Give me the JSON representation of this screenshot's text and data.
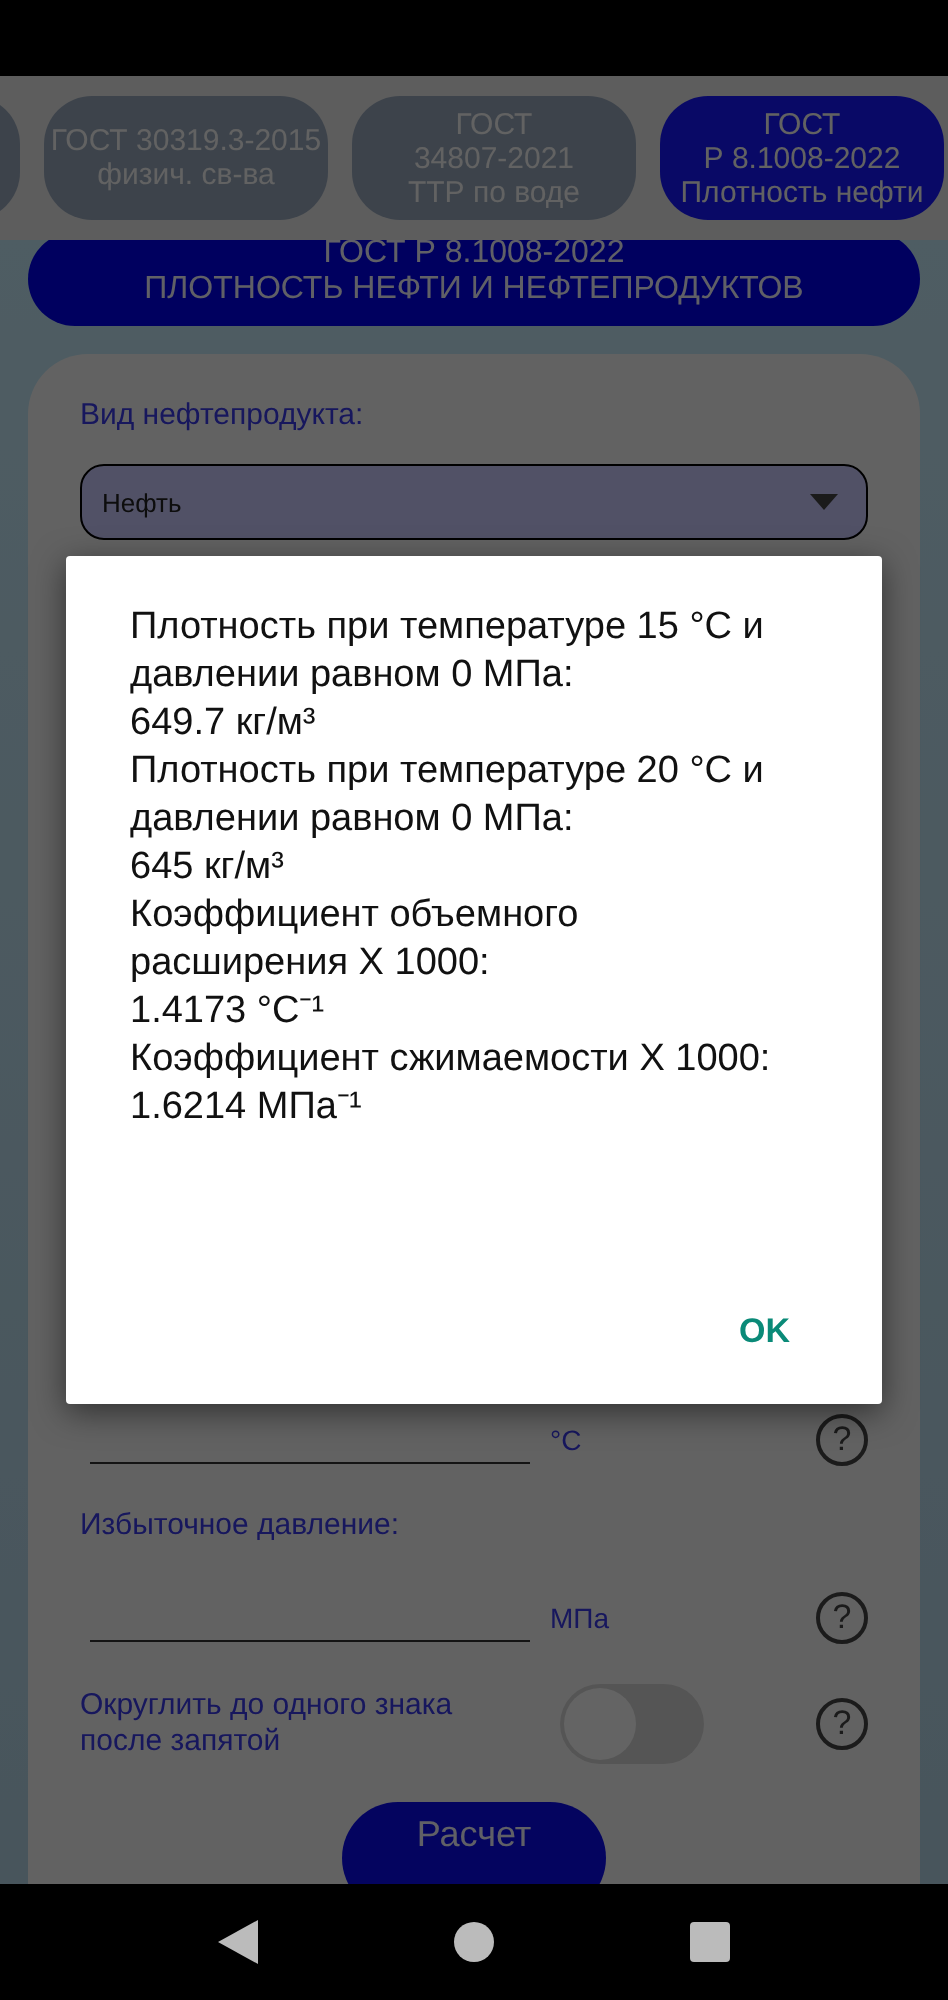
{
  "tabs": [
    {
      "label": "ГОСТ 30319.3-2015\nфизич. св-ва",
      "selected": false
    },
    {
      "label": "ГОСТ\n34807-2021\nТТР по воде",
      "selected": false
    },
    {
      "label": "ГОСТ\nР 8.1008-2022\nПлотность нефти",
      "selected": true
    }
  ],
  "header": "ГОСТ Р 8.1008-2022\nПЛОТНОСТЬ НЕФТИ И НЕФТЕПРОДУКТОВ",
  "product": {
    "label": "Вид нефтепродукта:",
    "value": "Нефть"
  },
  "temperature": {
    "unit": "°C",
    "help": "?"
  },
  "pressure": {
    "label": "Избыточное давление:",
    "unit": "МПа",
    "help": "?"
  },
  "rounding": {
    "label": "Округлить до одного знака после запятой",
    "on": false,
    "help": "?"
  },
  "calculate_button": "Расчет",
  "dialog": {
    "results": [
      {
        "label": "Плотность при температуре 15 °C и давлении равном 0 МПа:",
        "value": "649.7 кг/м³"
      },
      {
        "label": "Плотность при температуре 20 °C и давлении равном 0 МПа:",
        "value": "645 кг/м³"
      },
      {
        "label": "Коэффициент объемного расширения X 1000:",
        "value": "1.4173 °C⁻¹"
      },
      {
        "label": "Коэффициент сжимаемости X 1000:",
        "value": "1.6214 МПа⁻¹"
      }
    ],
    "ok_button": "OK"
  }
}
